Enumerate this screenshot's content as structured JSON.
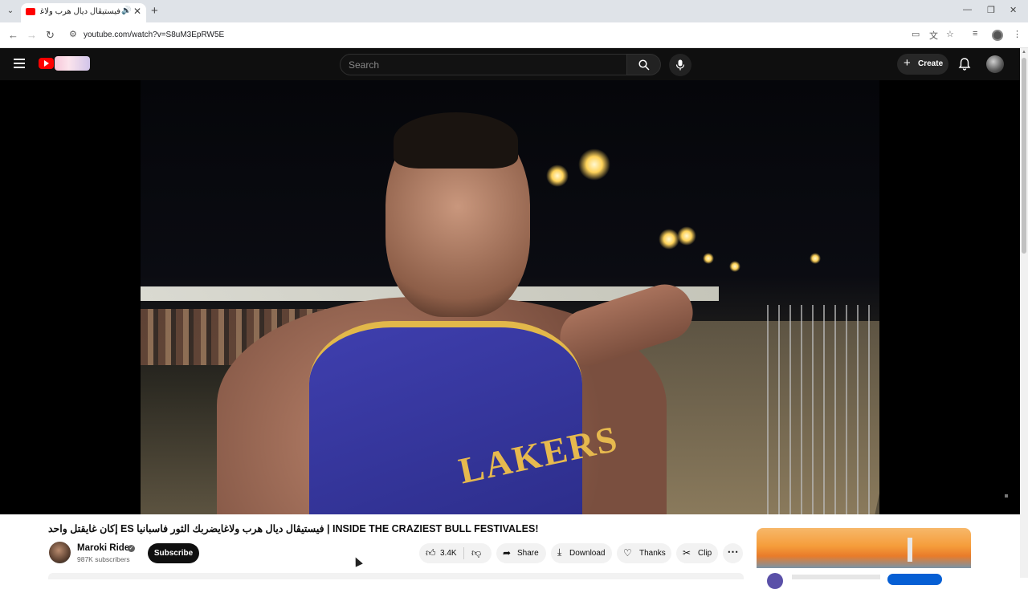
{
  "browser": {
    "tab_title": "فيستيڤال ديال هرب ولاغايضربك الثور فاسبانيا | INSIDE THE CRAZIEST BULL FESTIVAL",
    "url": "youtube.com/watch?v=S8uM3EpRW5E"
  },
  "youtube": {
    "search_placeholder": "Search",
    "create_label": "Create"
  },
  "video": {
    "title": "إكان غايقتل واحد ES فيستيڤال ديال هرب ولاغايضربك الثور فاسبانيا | INSIDE THE CRAZIEST BULL FESTIVALES!",
    "jersey_text": "LAKERS"
  },
  "channel": {
    "name": "Maroki Rider",
    "subscribers": "987K subscribers",
    "subscribe_label": "Subscribe"
  },
  "actions": {
    "likes": "3.4K",
    "share": "Share",
    "download": "Download",
    "thanks": "Thanks",
    "clip": "Clip"
  },
  "colors": {
    "youtube_red": "#ff0000",
    "header_bg": "#0f0f0f",
    "pill_bg": "#f2f2f2"
  }
}
